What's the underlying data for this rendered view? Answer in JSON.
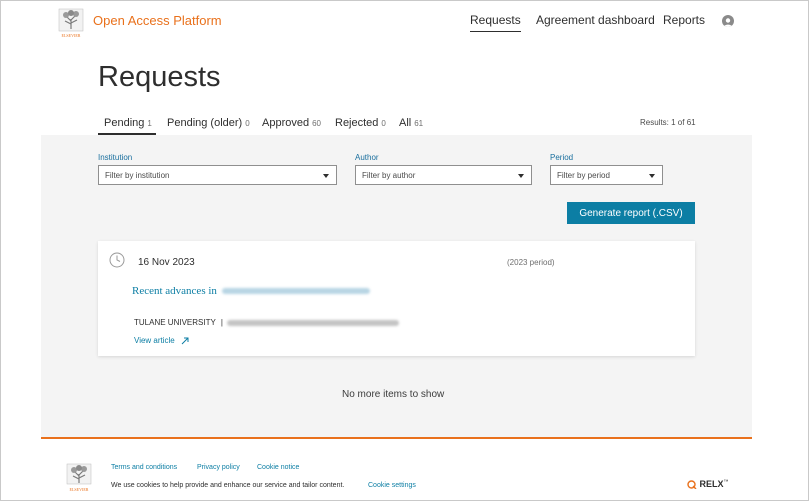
{
  "header": {
    "brand": "Open Access Platform",
    "logo_word": "ELSEVIER",
    "nav": [
      "Requests",
      "Agreement dashboard",
      "Reports"
    ],
    "active_nav": "Requests"
  },
  "page_title": "Requests",
  "tabs": [
    {
      "label": "Pending",
      "count": "1",
      "active": true
    },
    {
      "label": "Pending (older)",
      "count": "0",
      "active": false
    },
    {
      "label": "Approved",
      "count": "60",
      "active": false
    },
    {
      "label": "Rejected",
      "count": "0",
      "active": false
    },
    {
      "label": "All",
      "count": "61",
      "active": false
    }
  ],
  "results": "Results: 1 of 61",
  "filters": {
    "institution": {
      "label": "Institution",
      "value": "Filter by institution"
    },
    "author": {
      "label": "Author",
      "value": "Filter by author"
    },
    "period": {
      "label": "Period",
      "value": "Filter by period"
    }
  },
  "generate_button": "Generate report (.CSV)",
  "request": {
    "date": "16 Nov 2023",
    "period": "(2023 period)",
    "title_prefix": "Recent advances in",
    "institution": "TULANE UNIVERSITY",
    "separator": "|",
    "view_article": "View article"
  },
  "no_more": "No more items to show",
  "footer": {
    "logo_word": "ELSEVIER",
    "links": [
      "Terms and conditions",
      "Privacy policy",
      "Cookie notice"
    ],
    "cookie_text": "We use cookies to help provide and enhance our service and tailor content.",
    "cookie_settings": "Cookie settings",
    "relx": "RELX",
    "relx_tm": "™"
  },
  "colors": {
    "accent": "#0c7ea4",
    "brand_orange": "#e9711c",
    "panel": "#f4f4f4"
  }
}
